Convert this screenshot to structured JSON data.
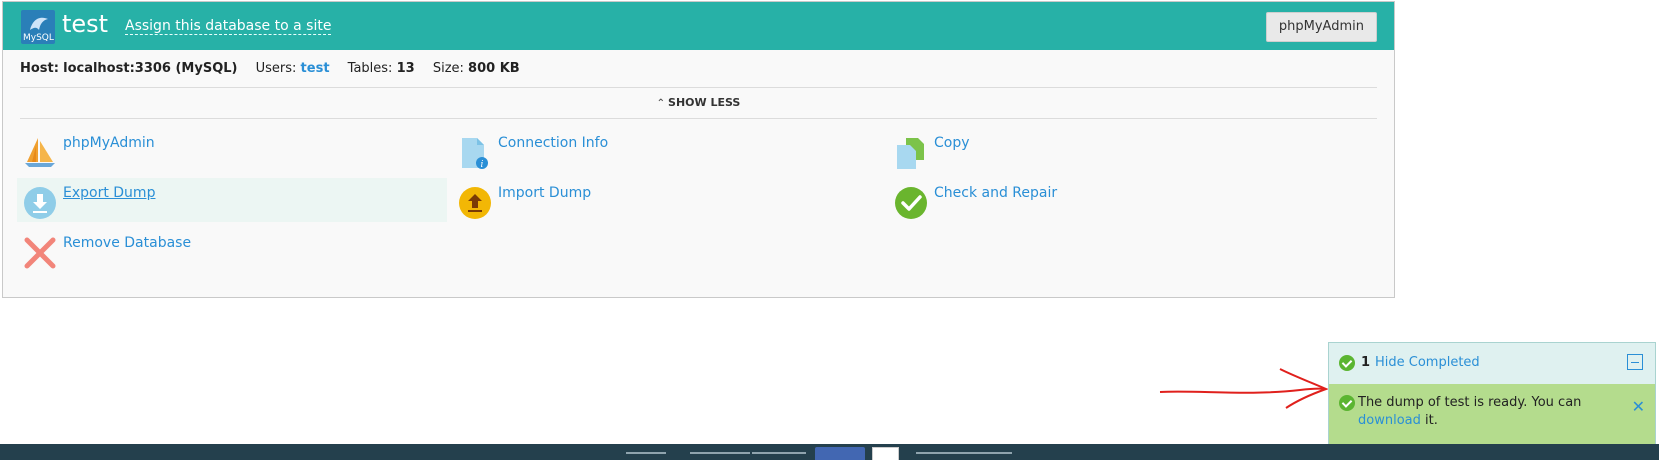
{
  "header": {
    "logo_text": "MySQL",
    "db_name": "test",
    "assign_link": "Assign this database to a site",
    "phpmyadmin_button": "phpMyAdmin"
  },
  "info": {
    "host_label": "Host:",
    "host_value": "localhost:3306 (MySQL)",
    "users_label": "Users:",
    "users_value": "test",
    "tables_label": "Tables:",
    "tables_value": "13",
    "size_label": "Size:",
    "size_value": "800 KB"
  },
  "toggle": {
    "label": "SHOW LESS"
  },
  "tools": [
    {
      "label": "phpMyAdmin",
      "icon": "sailboat-icon"
    },
    {
      "label": "Connection Info",
      "icon": "document-info-icon"
    },
    {
      "label": "Copy",
      "icon": "copy-icon"
    },
    {
      "label": "Export Dump",
      "icon": "download-icon"
    },
    {
      "label": "Import Dump",
      "icon": "upload-icon"
    },
    {
      "label": "Check and Repair",
      "icon": "checkmark-icon"
    },
    {
      "label": "Remove Database",
      "icon": "cross-icon"
    }
  ],
  "notifications": {
    "count": "1",
    "hide_completed": "Hide Completed",
    "message_prefix": "The dump of test is ready. You can",
    "download_link": "download",
    "message_suffix": "it."
  },
  "colors": {
    "header_bg": "#27b1a7",
    "link": "#2a8fd6",
    "success": "#5bb531",
    "notif_bg": "#b4dc8d",
    "footer_bg": "#24404d",
    "annotation_arrow": "#e0201c"
  }
}
